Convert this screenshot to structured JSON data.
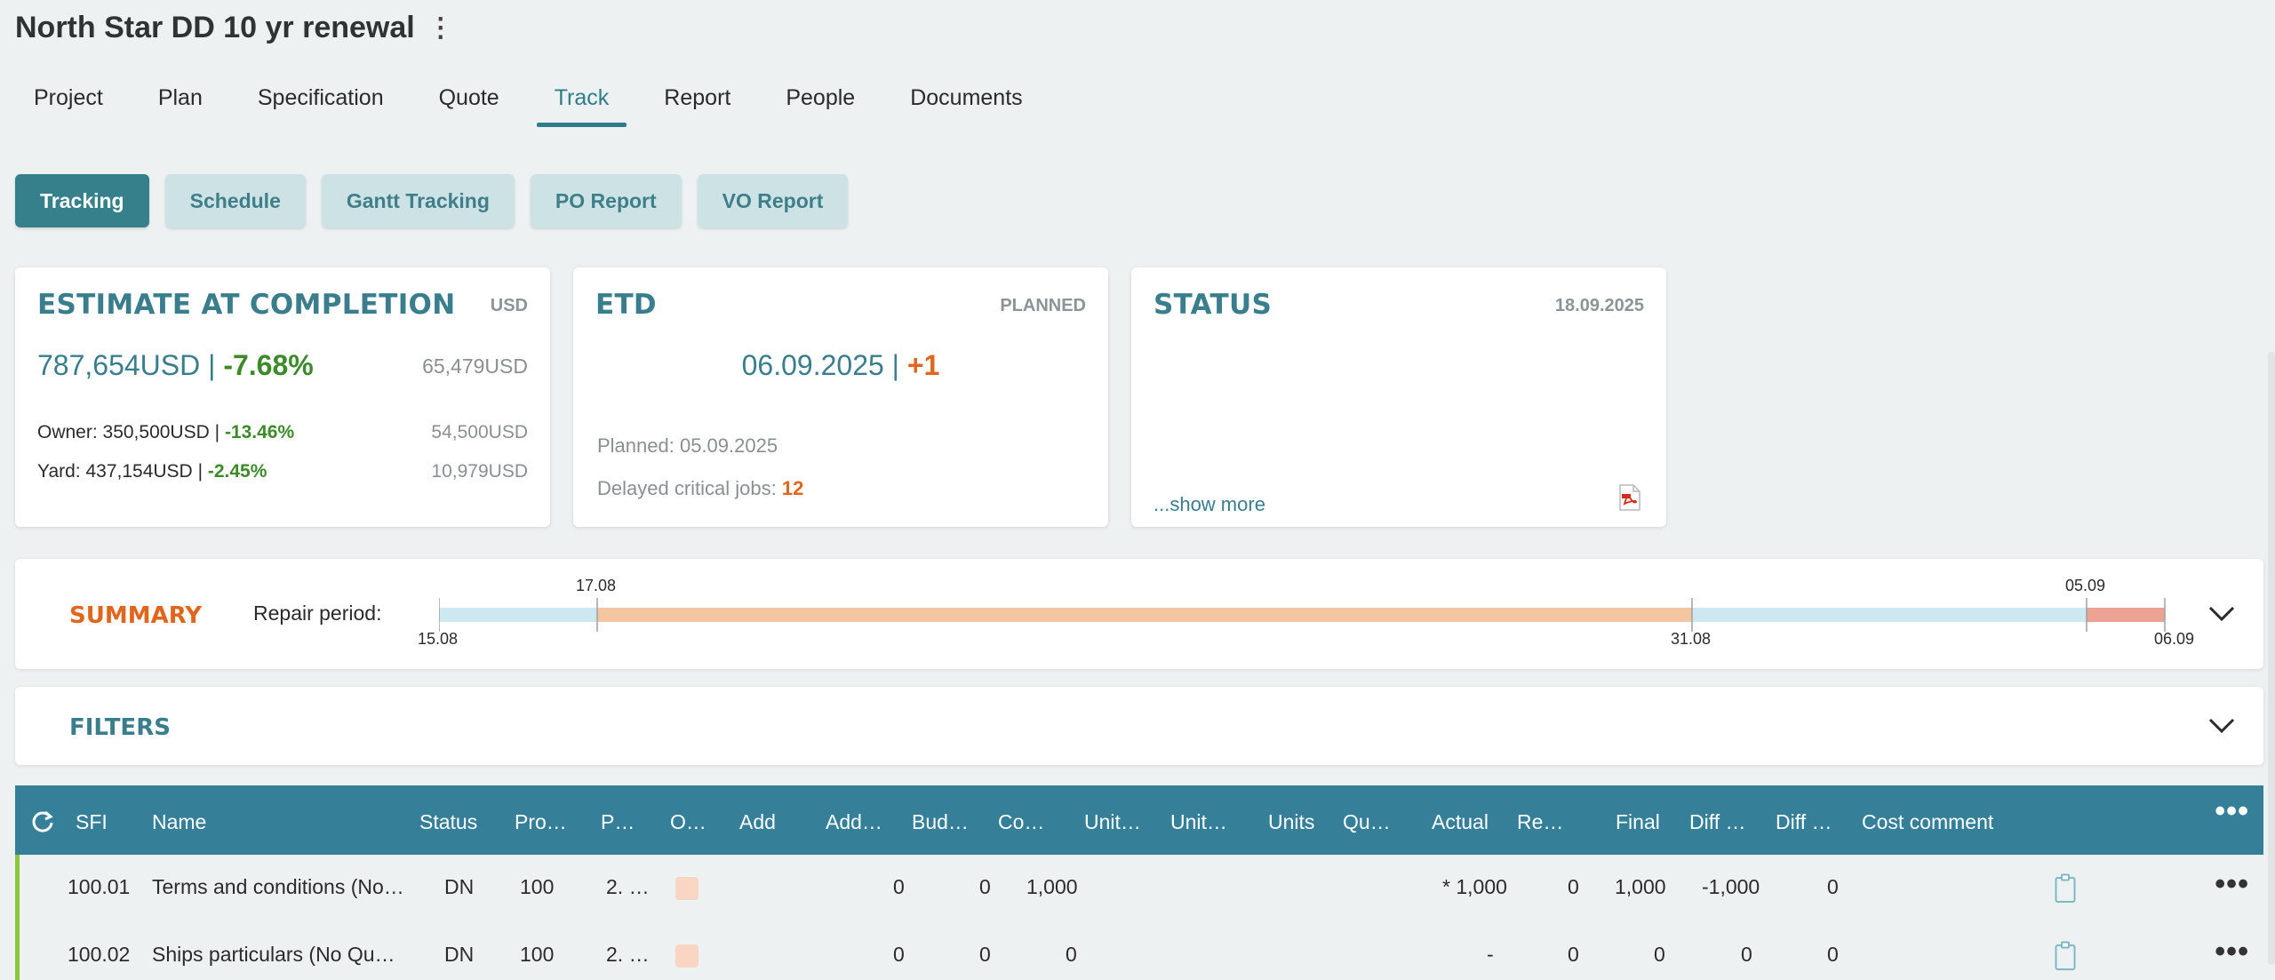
{
  "project": {
    "title": "North Star DD 10 yr renewal"
  },
  "tabs": [
    "Project",
    "Plan",
    "Specification",
    "Quote",
    "Track",
    "Report",
    "People",
    "Documents"
  ],
  "active_tab": "Track",
  "subtabs": [
    "Tracking",
    "Schedule",
    "Gantt Tracking",
    "PO Report",
    "VO Report"
  ],
  "active_subtab": "Tracking",
  "eac": {
    "title": "ESTIMATE AT COMPLETION",
    "currency": "USD",
    "total": "787,654USD",
    "sep": "|",
    "total_pct": "-7.68%",
    "total_diff": "65,479USD",
    "owner_label": "Owner: 350,500USD",
    "owner_pct": "-13.46%",
    "owner_diff": "54,500USD",
    "yard_label": "Yard: 437,154USD",
    "yard_pct": "-2.45%",
    "yard_diff": "10,979USD"
  },
  "etd": {
    "title": "ETD",
    "tag": "PLANNED",
    "date": "06.09.2025",
    "sep": "|",
    "delta": "+1",
    "planned": "Planned: 05.09.2025",
    "delayed_label": "Delayed critical jobs:",
    "delayed_value": "12"
  },
  "status": {
    "title": "STATUS",
    "date": "18.09.2025",
    "show_more": "...show more",
    "icon": "pdf-icon"
  },
  "summary": {
    "title": "SUMMARY",
    "repair_label": "Repair period:",
    "dates": {
      "start": "15.08",
      "mark_1": "17.08",
      "mark_2": "31.08",
      "mark_3": "05.09",
      "end": "06.09"
    }
  },
  "filters": {
    "title": "FILTERS"
  },
  "table": {
    "columns": [
      "SFI",
      "Name",
      "Status",
      "Pro…",
      "P…",
      "O…",
      "Add",
      "Add…",
      "Bud…",
      "Co…",
      "Unit…",
      "Unit…",
      "Units",
      "Qu…",
      "Actual",
      "Re…",
      "Final",
      "Diff …",
      "Diff …",
      "Cost comment"
    ],
    "rows": [
      {
        "sfi": "100.01",
        "name": "Terms and conditions (No…",
        "status": "DN",
        "pro": "100",
        "p": "2. …",
        "add2": "0",
        "bud": "0",
        "co": "1,000",
        "actual": "* 1,000",
        "re": "0",
        "final": "1,000",
        "diff1": "-1,000",
        "diff2": "0"
      },
      {
        "sfi": "100.02",
        "name": "Ships particulars (No Qu…",
        "status": "DN",
        "pro": "100",
        "p": "2. …",
        "add2": "0",
        "bud": "0",
        "co": "0",
        "actual": "-",
        "re": "0",
        "final": "0",
        "diff1": "0",
        "diff2": "0"
      }
    ]
  },
  "colors": {
    "accent": "#35808a",
    "header": "#367f98",
    "green": "#3c8a2a",
    "orange": "#e0661f",
    "bar_light": "#cde8f1",
    "bar_orange": "#f3c5a1",
    "bar_red": "#eda393"
  }
}
